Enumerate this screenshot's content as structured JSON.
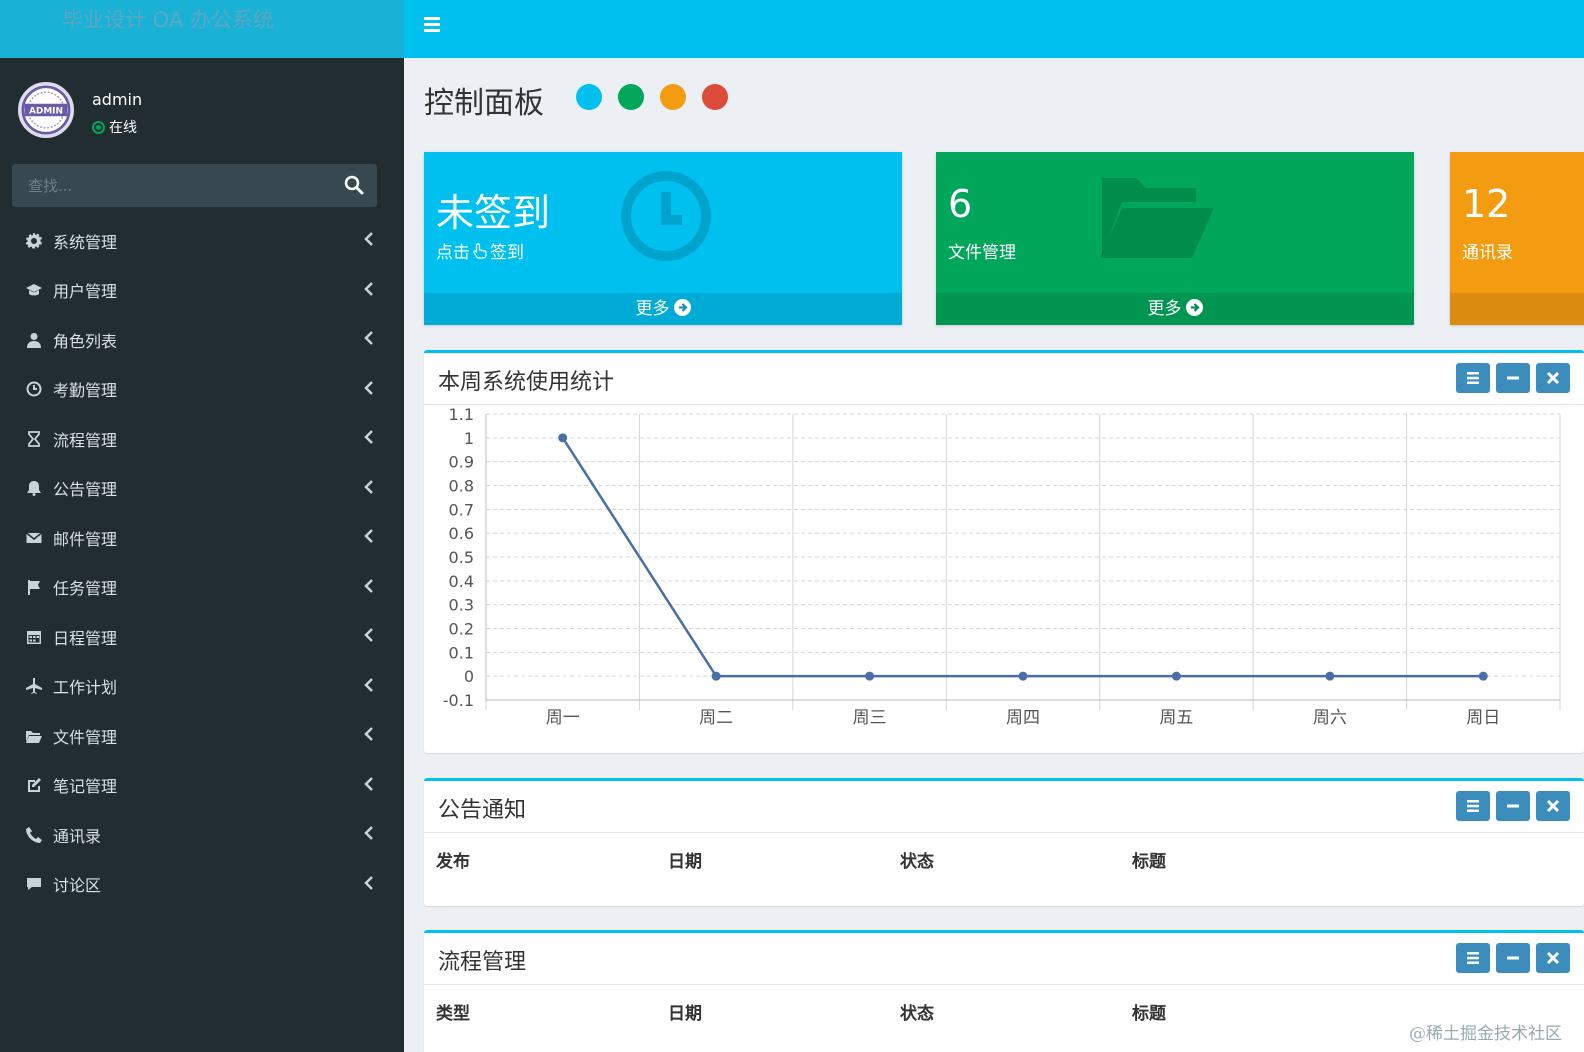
{
  "app": {
    "title": "毕业设计 OA 办公系统"
  },
  "user": {
    "name": "admin",
    "status": "在线",
    "avatar_text": "ADMIN"
  },
  "search": {
    "placeholder": "查找..."
  },
  "sidebar": {
    "items": [
      {
        "label": "系统管理",
        "icon": "gear-icon"
      },
      {
        "label": "用户管理",
        "icon": "graduation-cap-icon"
      },
      {
        "label": "角色列表",
        "icon": "user-icon"
      },
      {
        "label": "考勤管理",
        "icon": "clock-icon"
      },
      {
        "label": "流程管理",
        "icon": "hourglass-icon"
      },
      {
        "label": "公告管理",
        "icon": "bell-icon"
      },
      {
        "label": "邮件管理",
        "icon": "envelope-icon"
      },
      {
        "label": "任务管理",
        "icon": "flag-icon"
      },
      {
        "label": "日程管理",
        "icon": "calendar-icon"
      },
      {
        "label": "工作计划",
        "icon": "plane-icon"
      },
      {
        "label": "文件管理",
        "icon": "folder-open-icon"
      },
      {
        "label": "笔记管理",
        "icon": "edit-icon"
      },
      {
        "label": "通讯录",
        "icon": "phone-icon"
      },
      {
        "label": "讨论区",
        "icon": "comment-icon"
      }
    ]
  },
  "page": {
    "title": "控制面板",
    "skin_colors": [
      "#00c0ef",
      "#00a65a",
      "#f39c12",
      "#dd4b39"
    ]
  },
  "info_boxes": [
    {
      "big": "未签到",
      "sub_prefix": "点击",
      "sub_suffix": "签到",
      "footer": "更多",
      "color": "#00c0ef",
      "icon": "clock-icon"
    },
    {
      "big": "6",
      "sub": "文件管理",
      "footer": "更多",
      "color": "#00a65a",
      "icon": "folder-open-icon"
    },
    {
      "big": "12",
      "sub": "通讯录",
      "color": "#f39c12"
    }
  ],
  "stats_box": {
    "title": "本周系统使用统计"
  },
  "chart_data": {
    "type": "line",
    "categories": [
      "周一",
      "周二",
      "周三",
      "周四",
      "周五",
      "周六",
      "周日"
    ],
    "values": [
      1,
      0,
      0,
      0,
      0,
      0,
      0
    ],
    "ylim": [
      -0.1,
      1.1
    ],
    "yticks": [
      "1.1",
      "1",
      "0.9",
      "0.8",
      "0.7",
      "0.6",
      "0.5",
      "0.4",
      "0.3",
      "0.2",
      "0.1",
      "0",
      "-0.1"
    ],
    "grid": true,
    "line_color": "#4a6fa5"
  },
  "notice_box": {
    "title": "公告通知",
    "columns": [
      "发布",
      "日期",
      "状态",
      "标题"
    ]
  },
  "process_box": {
    "title": "流程管理",
    "columns": [
      "类型",
      "日期",
      "状态",
      "标题"
    ]
  },
  "watermark": "@稀土掘金技术社区"
}
